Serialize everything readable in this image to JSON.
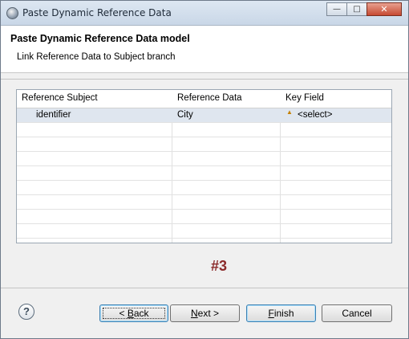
{
  "window": {
    "title": "Paste Dynamic Reference Data"
  },
  "header": {
    "title": "Paste Dynamic Reference Data model",
    "subtitle": "Link Reference Data to Subject branch"
  },
  "table": {
    "columns": [
      "Reference Subject",
      "Reference Data",
      "Key Field"
    ],
    "rows": [
      {
        "subject": "identifier",
        "data": "City",
        "key": "<select>"
      }
    ]
  },
  "step_marker": "#3",
  "buttons": {
    "back": {
      "pre": "< ",
      "mnemonic": "B",
      "post": "ack"
    },
    "next": {
      "mnemonic": "N",
      "post": "ext >"
    },
    "finish": {
      "mnemonic": "F",
      "post": "inish"
    },
    "cancel": "Cancel"
  },
  "icons": {
    "help": "help-icon",
    "app": "app-icon",
    "warning": "warning-icon"
  }
}
